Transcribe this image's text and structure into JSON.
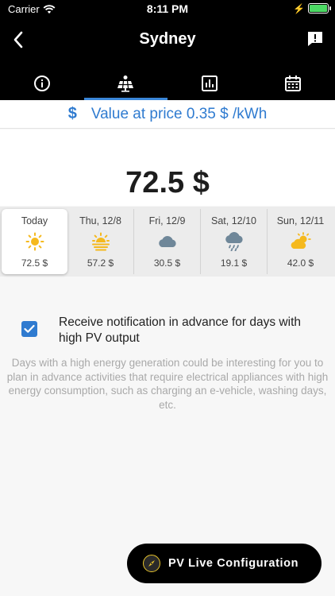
{
  "status": {
    "carrier": "Carrier",
    "time": "8:11 PM"
  },
  "header": {
    "title": "Sydney"
  },
  "tabs": [
    {
      "name": "info",
      "active": false
    },
    {
      "name": "solar-panel",
      "active": true
    },
    {
      "name": "chart",
      "active": false
    },
    {
      "name": "calendar",
      "active": false
    }
  ],
  "price": {
    "text": "Value at price 0.35 $ /kWh"
  },
  "main": {
    "value": "72.5 $"
  },
  "forecast": [
    {
      "day": "Today",
      "icon": "sun-icon",
      "value": "72.5 $"
    },
    {
      "day": "Thu, 12/8",
      "icon": "sunrise-icon",
      "value": "57.2 $"
    },
    {
      "day": "Fri, 12/9",
      "icon": "cloud-icon",
      "value": "30.5 $"
    },
    {
      "day": "Sat, 12/10",
      "icon": "rain-cloud-icon",
      "value": "19.1 $"
    },
    {
      "day": "Sun, 12/11",
      "icon": "partly-cloudy-icon",
      "value": "42.0 $"
    }
  ],
  "notification": {
    "label": "Receive notification in advance for days with high PV output",
    "checked": true,
    "description": "Days with a high energy generation could be interesting for you to plan in advance activities that require electrical appliances with high energy consumption, such as charging an e-vehicle, washing days, etc."
  },
  "fab": {
    "label": "PV Live Configuration"
  },
  "colors": {
    "accent": "#2f7bd0",
    "header_bg": "#000000",
    "sun": "#f5b91e"
  }
}
